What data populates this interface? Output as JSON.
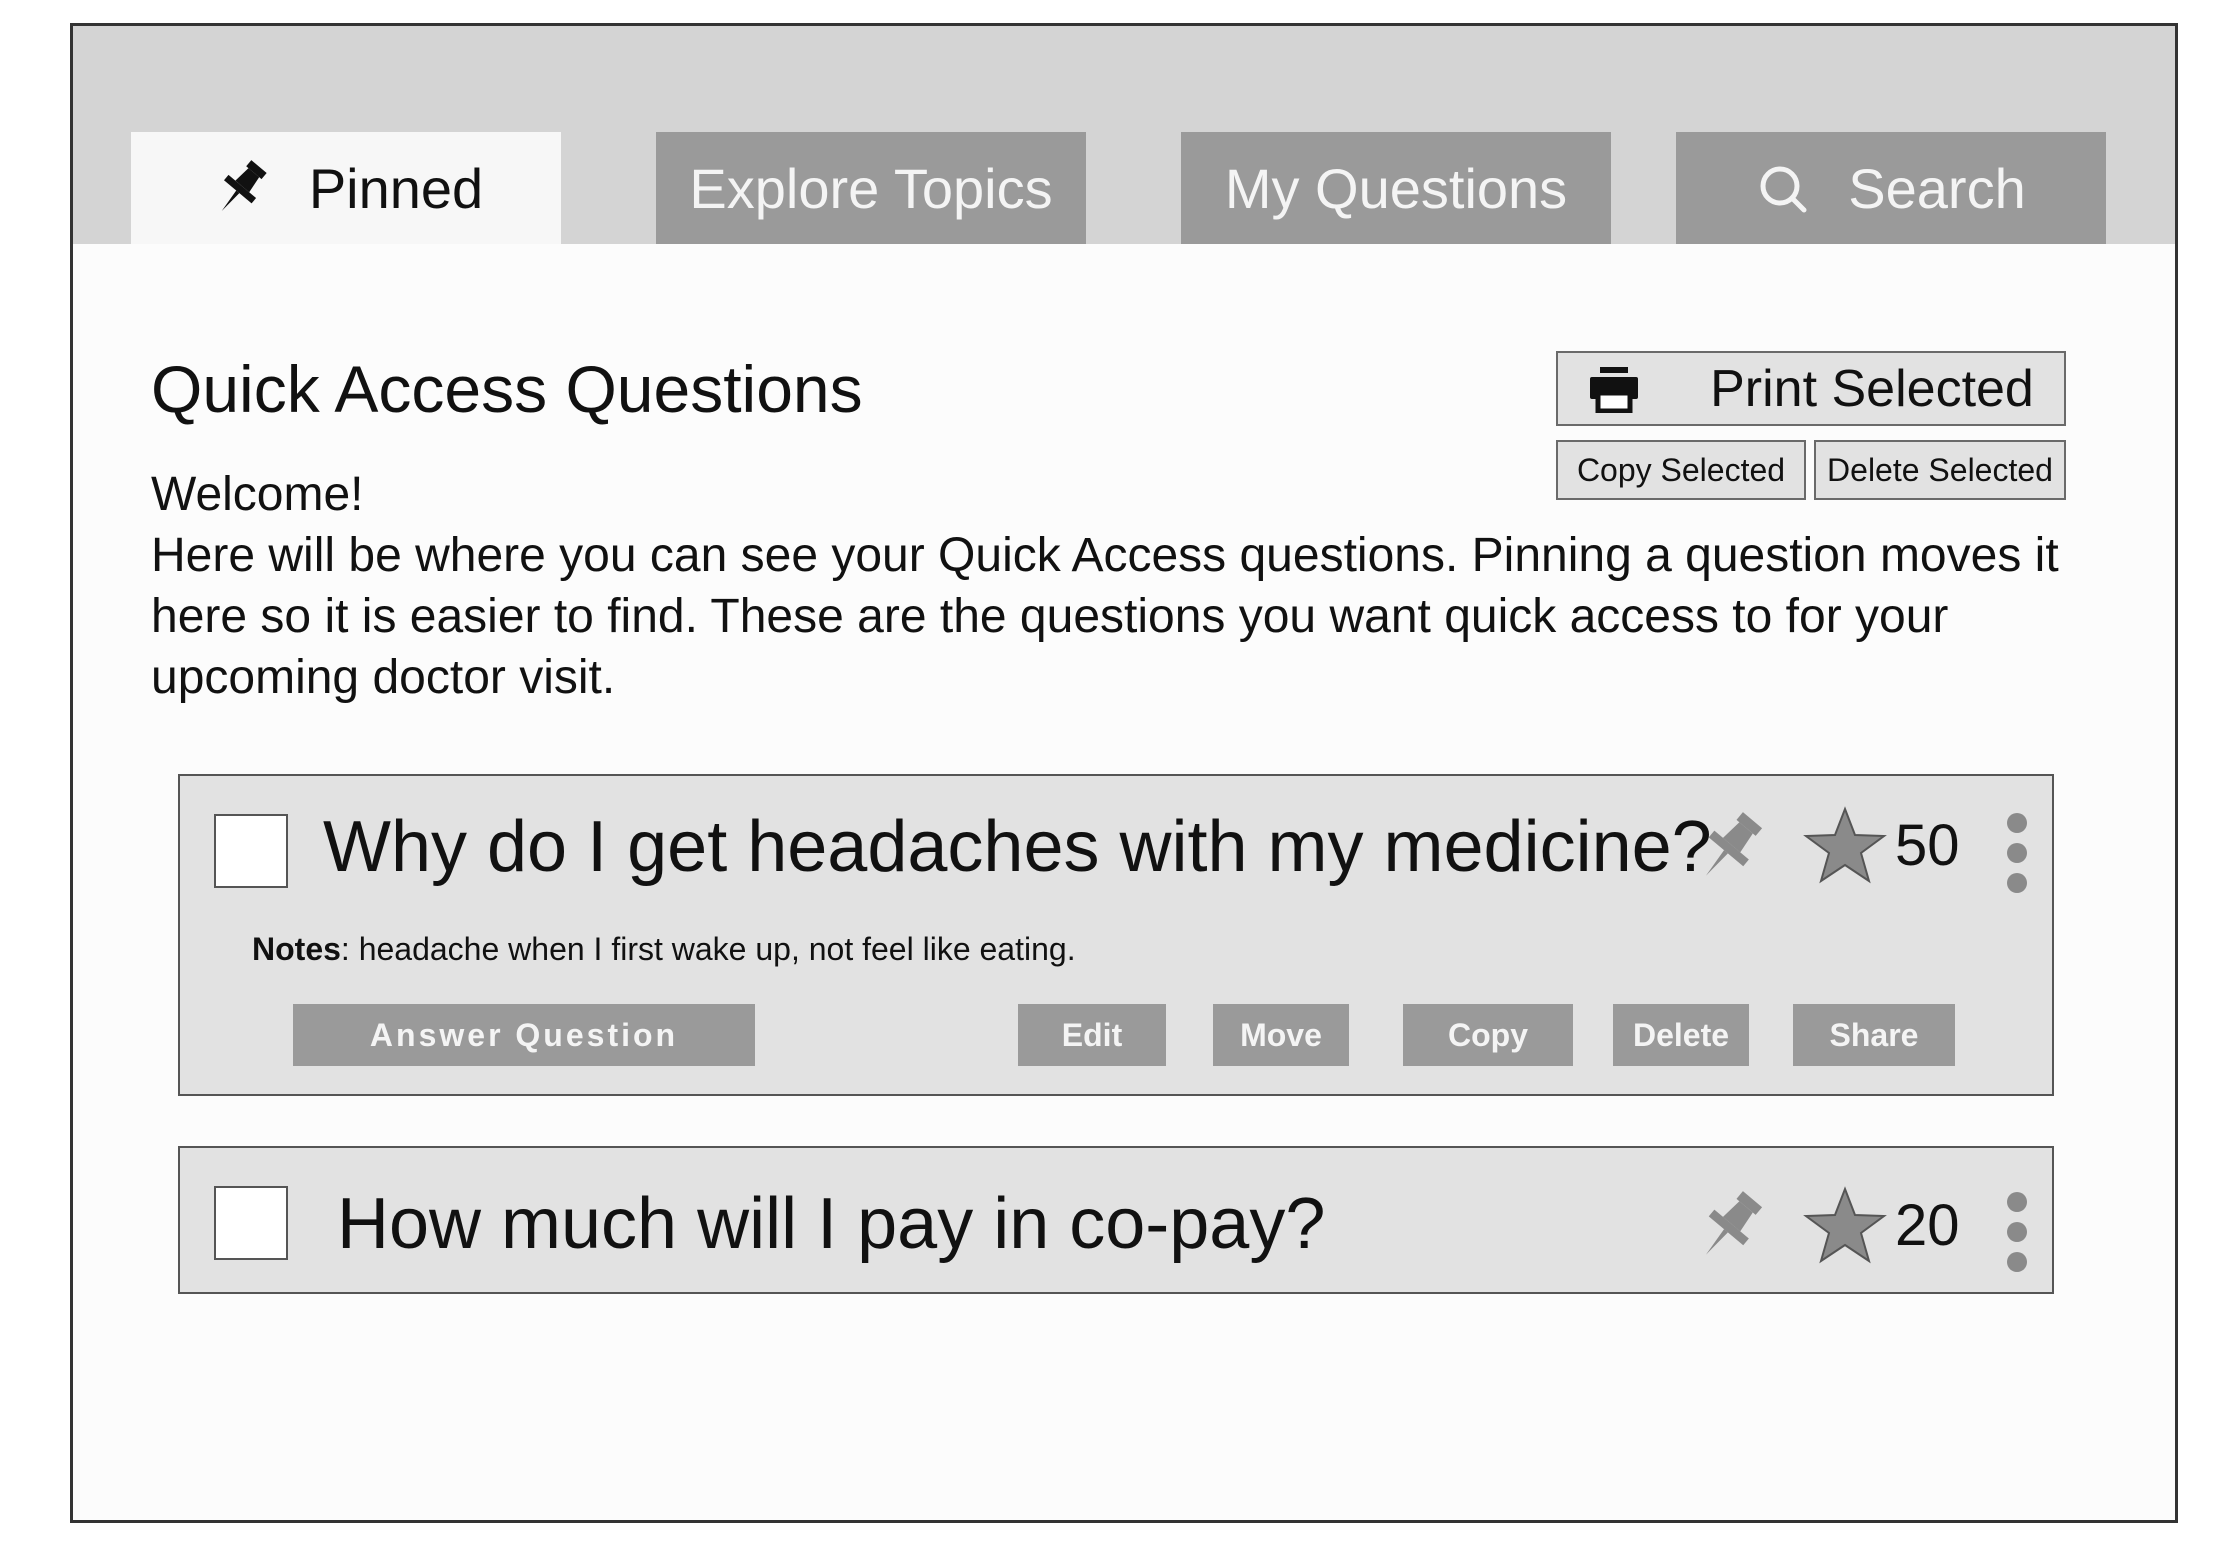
{
  "tabs": [
    {
      "label": "Pinned",
      "icon": "pin-icon",
      "active": true
    },
    {
      "label": "Explore Topics",
      "active": false
    },
    {
      "label": "My Questions",
      "active": false
    },
    {
      "label": "Search",
      "icon": "search-icon",
      "active": false
    }
  ],
  "main": {
    "title": "Quick Access Questions",
    "welcome_heading": "Welcome!",
    "welcome_body": "Here will be where you can see your Quick Access questions. Pinning a question moves it here so it is easier to find. These are the questions you want quick access to for your upcoming doctor visit."
  },
  "toolbar": {
    "print_label": "Print Selected",
    "copy_selected_label": "Copy Selected",
    "delete_selected_label": "Delete Selected"
  },
  "questions": [
    {
      "text": "Why do I get headaches with my medicine?",
      "score": "50",
      "notes_label": "Notes",
      "notes_text": ": headache when I first wake up, not feel like eating.",
      "actions": {
        "answer": "Answer Question",
        "edit": "Edit",
        "move": "Move",
        "copy": "Copy",
        "delete": "Delete",
        "share": "Share"
      }
    },
    {
      "text": "How much will I pay in co-pay?",
      "score": "20"
    }
  ],
  "colors": {
    "tab_bar": "#d4d4d4",
    "tab_inactive": "#9a9a9a",
    "tab_active": "#f7f7f7",
    "card_bg": "#e2e2e2",
    "page_bg": "#fcfcfc"
  }
}
